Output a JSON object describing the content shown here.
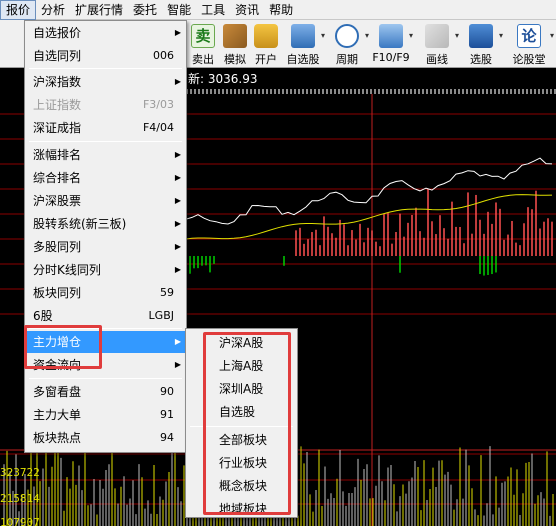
{
  "menubar": {
    "items": [
      "报价",
      "分析",
      "扩展行情",
      "委托",
      "智能",
      "工具",
      "资讯",
      "帮助"
    ]
  },
  "toolbar": {
    "tools": [
      {
        "label": "卖出",
        "icon": "sell-icon",
        "glyph": "卖"
      },
      {
        "label": "模拟",
        "icon": "gavel-icon"
      },
      {
        "label": "开户",
        "icon": "lock-icon"
      },
      {
        "label": "自选股",
        "icon": "star-list-icon"
      },
      {
        "label": "周期",
        "icon": "clock-icon"
      },
      {
        "label": "F10/F9",
        "icon": "f10-icon"
      },
      {
        "label": "画线",
        "icon": "pencil-icon"
      },
      {
        "label": "选股",
        "icon": "select-stock-icon"
      },
      {
        "label": "论股堂",
        "icon": "forum-icon",
        "glyph": "论"
      }
    ]
  },
  "price_strip": {
    "text": "新: 3036.93"
  },
  "dropdown": {
    "items": [
      {
        "label": "自选报价",
        "shortcut": "",
        "arrow": true,
        "disabled": false
      },
      {
        "label": "自选同列",
        "shortcut": "006",
        "arrow": false,
        "disabled": false
      },
      {
        "label": "沪深指数",
        "shortcut": "",
        "arrow": true,
        "disabled": false
      },
      {
        "label": "上证指数",
        "shortcut": "F3/03",
        "arrow": false,
        "disabled": true
      },
      {
        "label": "深证成指",
        "shortcut": "F4/04",
        "arrow": false,
        "disabled": false
      },
      {
        "label": "涨幅排名",
        "shortcut": "",
        "arrow": true,
        "disabled": false
      },
      {
        "label": "综合排名",
        "shortcut": "",
        "arrow": true,
        "disabled": false
      },
      {
        "label": "沪深股票",
        "shortcut": "",
        "arrow": true,
        "disabled": false
      },
      {
        "label": "股转系统(新三板)",
        "shortcut": "",
        "arrow": true,
        "disabled": false
      },
      {
        "label": "多股同列",
        "shortcut": "",
        "arrow": true,
        "disabled": false
      },
      {
        "label": "分时K线同列",
        "shortcut": "",
        "arrow": true,
        "disabled": false
      },
      {
        "label": "板块同列",
        "shortcut": "59",
        "arrow": false,
        "disabled": false
      },
      {
        "label": "6股",
        "shortcut": "LGBJ",
        "arrow": false,
        "disabled": false
      },
      {
        "label": "主力增仓",
        "shortcut": "",
        "arrow": true,
        "disabled": false,
        "highlighted": true
      },
      {
        "label": "资金流向",
        "shortcut": "",
        "arrow": true,
        "disabled": false
      },
      {
        "label": "多窗看盘",
        "shortcut": "90",
        "arrow": false,
        "disabled": false
      },
      {
        "label": "主力大单",
        "shortcut": "91",
        "arrow": false,
        "disabled": false
      },
      {
        "label": "板块热点",
        "shortcut": "94",
        "arrow": false,
        "disabled": false
      }
    ]
  },
  "submenu": {
    "items": [
      "沪深A股",
      "上海A股",
      "深圳A股",
      "自选股",
      "全部板块",
      "行业板块",
      "概念板块",
      "地域板块"
    ]
  },
  "axis_labels": [
    "323722",
    "215814",
    "107907"
  ],
  "colors": {
    "highlight": "#3399ff",
    "annotation": "#e03c3c",
    "gridline": "#8b0000",
    "up_bar": "#ff5050",
    "down_bar": "#00d000",
    "price_line": "#ffffff",
    "avg_line": "#e0e000"
  }
}
